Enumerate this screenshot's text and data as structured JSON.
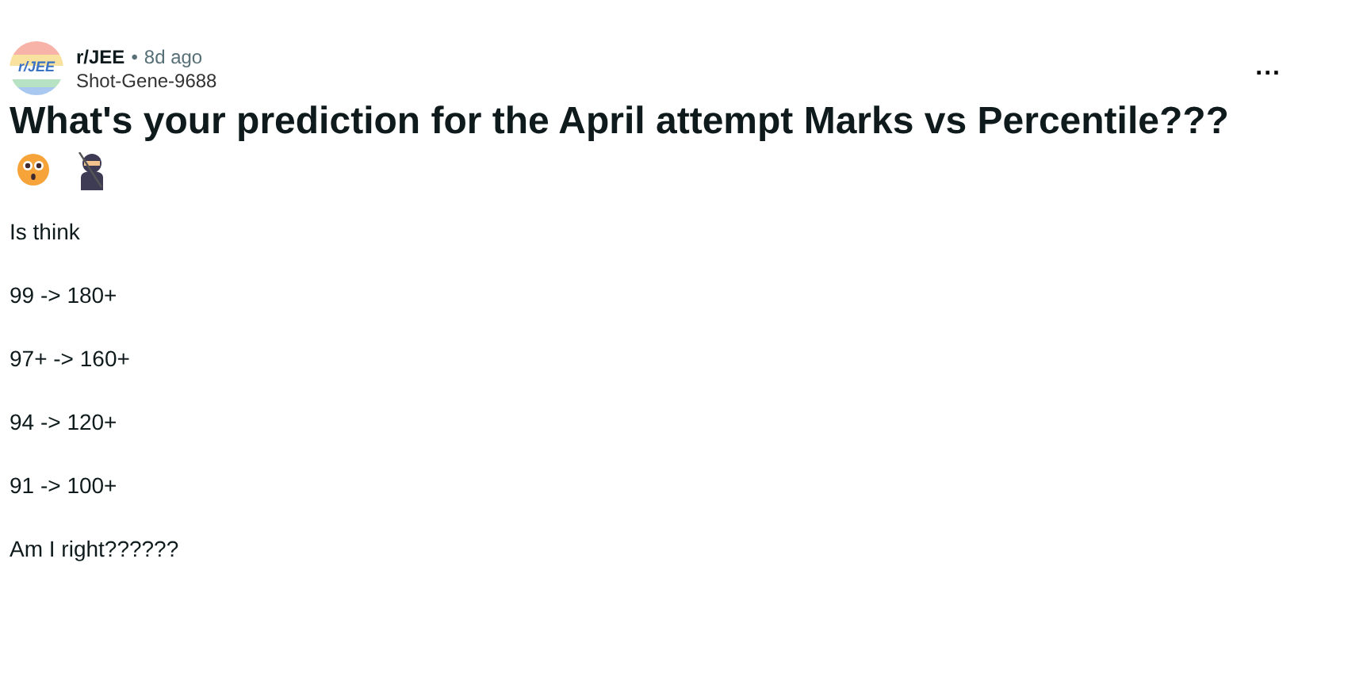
{
  "post": {
    "avatar_text": "r/JEE",
    "subreddit": "r/JEE",
    "separator": "•",
    "age": "8d ago",
    "author": "Shot-Gene-9688",
    "menu": "...",
    "title": "What's your prediction for the April attempt Marks vs Percentile???",
    "body": [
      "Is think",
      "99 -> 180+",
      "97+ -> 160+",
      "94 -> 120+",
      "91 -> 100+",
      "Am I right??????"
    ]
  }
}
